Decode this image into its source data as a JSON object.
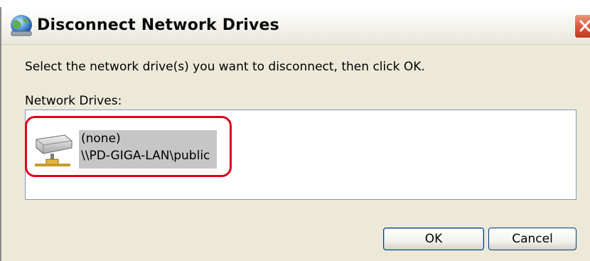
{
  "dialog": {
    "title": "Disconnect Network Drives",
    "close_icon": "close-icon",
    "instructions": "Select the network drive(s) you want to disconnect, then click OK.",
    "drives_label": "Network Drives:",
    "drives": [
      {
        "name": "(none)",
        "path": "\\\\PD-GIGA-LAN\\public",
        "icon": "network-drive-icon",
        "selected": true
      }
    ],
    "ok_label": "OK",
    "cancel_label": "Cancel"
  },
  "colors": {
    "dialog_background": "#ece9d8",
    "selection_highlight": "#c6c6c6",
    "annotation_outline": "#e0001b",
    "close_button": "#d8553b"
  }
}
